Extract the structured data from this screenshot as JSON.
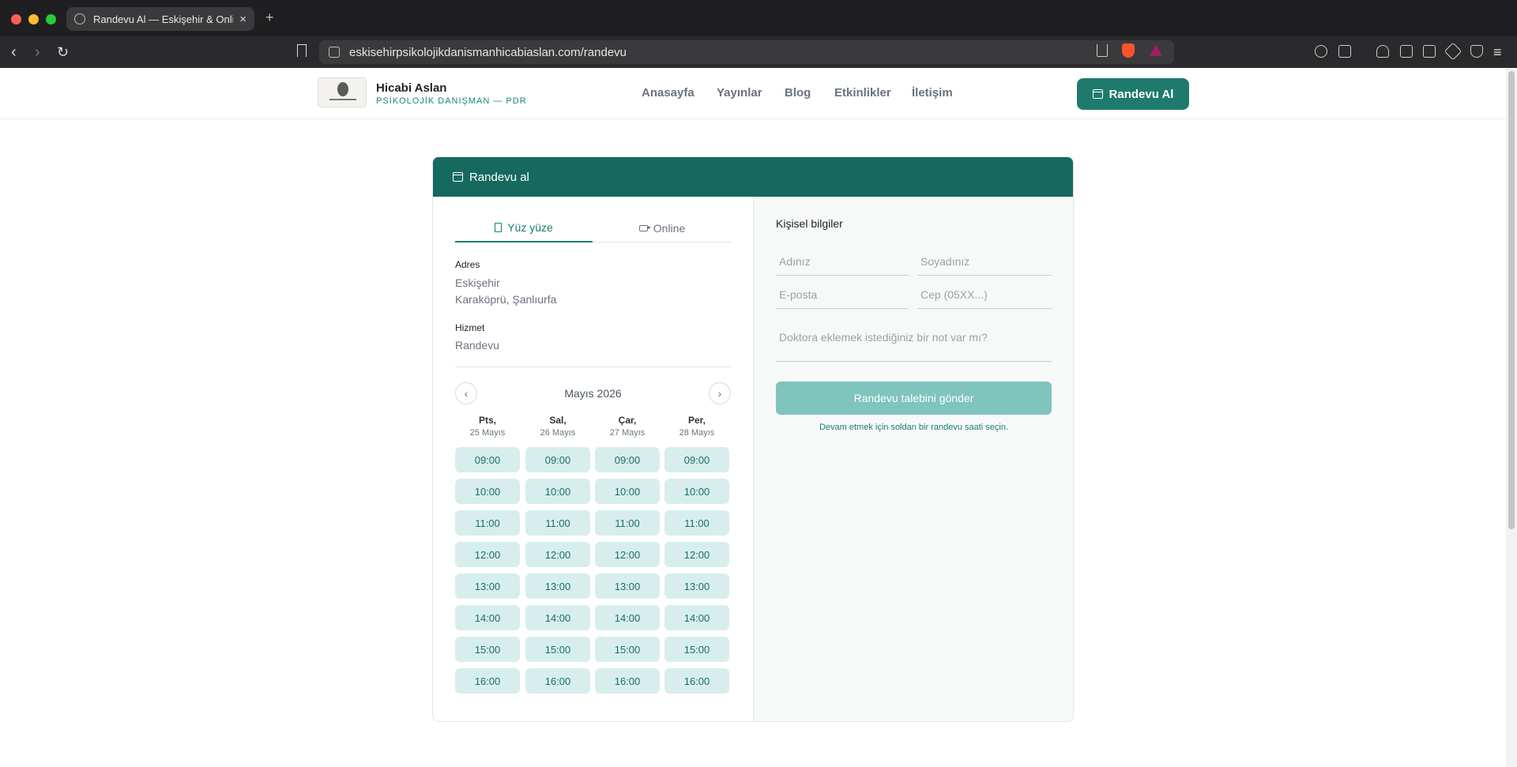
{
  "browser": {
    "tab_title": "Randevu Al — Eskişehir & Online",
    "new_tab": "+",
    "tab_close": "×",
    "url": "eskisehirpsikolojikdanismanhicabiaslan.com/randevu"
  },
  "site": {
    "brand_name": "Hicabi Aslan",
    "brand_subtitle": "PSİKOLOJİK DANIŞMAN — PDR",
    "nav": [
      "Anasayfa",
      "Yayınlar",
      "Blog",
      "Etkinlikler",
      "İletişim"
    ],
    "cta_label": "Randevu Al"
  },
  "booking": {
    "header_title": "Randevu al",
    "tabs": [
      "Yüz yüze",
      "Online"
    ],
    "active_tab": "Yüz yüze",
    "address_label": "Adres",
    "address_line1": "Eskişehir",
    "address_line2": "Karaköprü, Şanlıurfa",
    "service_label": "Hizmet",
    "service_value": "Randevu",
    "month": "Mayıs 2026",
    "prev": "‹",
    "next": "›",
    "days": [
      {
        "name": "Pts,",
        "date": "25 Mayıs"
      },
      {
        "name": "Sal,",
        "date": "26 Mayıs"
      },
      {
        "name": "Çar,",
        "date": "27 Mayıs"
      },
      {
        "name": "Per,",
        "date": "28 Mayıs"
      }
    ],
    "slots": [
      "09:00",
      "10:00",
      "11:00",
      "12:00",
      "13:00",
      "14:00",
      "15:00",
      "16:00"
    ]
  },
  "form": {
    "section_title": "Kişisel bilgiler",
    "first_name_placeholder": "Adınız",
    "last_name_placeholder": "Soyadınız",
    "email_placeholder": "E-posta",
    "phone_placeholder": "Cep (05XX...)",
    "note_placeholder": "Doktora eklemek istediğiniz bir not var mı?",
    "submit_label": "Randevu talebini gönder",
    "hint": "Devam etmek için soldan bir randevu saati seçin."
  },
  "colors": {
    "brand_teal": "#16695f",
    "cta_teal": "#1f7a6e",
    "slot_bg": "#d8eeec",
    "submit_disabled": "#7fc4bd"
  }
}
